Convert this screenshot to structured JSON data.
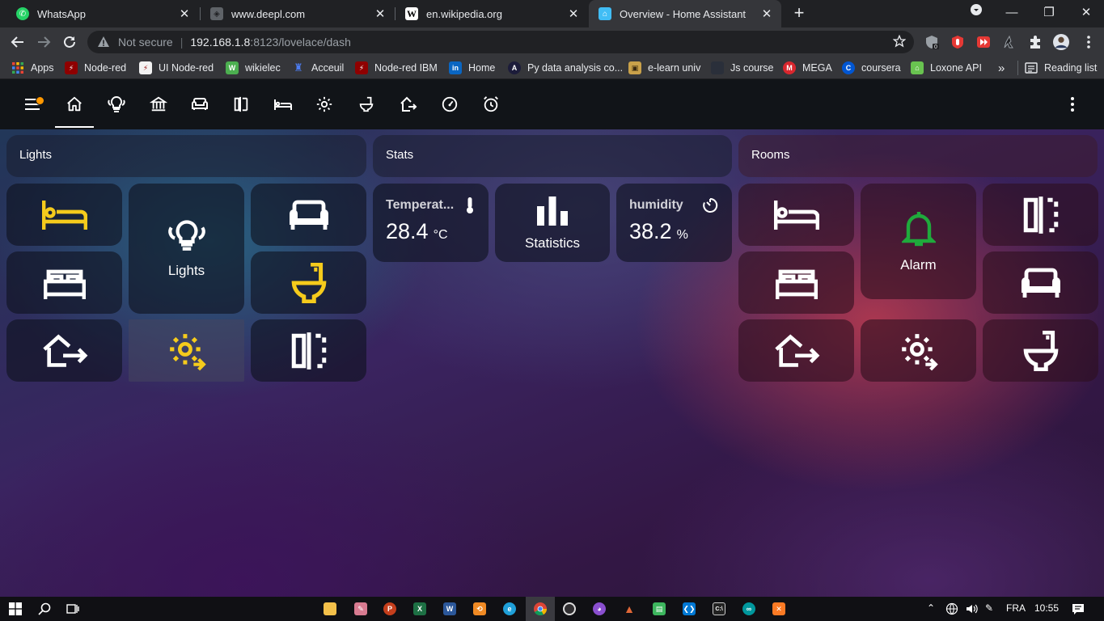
{
  "browser": {
    "tabs": [
      {
        "title": "WhatsApp",
        "icon": "whatsapp-icon"
      },
      {
        "title": "www.deepl.com",
        "icon": "deepl-icon"
      },
      {
        "title": "en.wikipedia.org",
        "icon": "wikipedia-icon"
      },
      {
        "title": "Overview - Home Assistant",
        "icon": "home-assistant-icon"
      }
    ],
    "address": {
      "security": "Not secure",
      "host": "192.168.1.8",
      "path": ":8123/lovelace/dash"
    },
    "bookmarks": [
      {
        "label": "Apps"
      },
      {
        "label": "Node-red"
      },
      {
        "label": "UI Node-red"
      },
      {
        "label": "wikielec"
      },
      {
        "label": "Acceuil"
      },
      {
        "label": "Node-red IBM"
      },
      {
        "label": "Home"
      },
      {
        "label": "Py data analysis co..."
      },
      {
        "label": "e-learn univ"
      },
      {
        "label": "Js course"
      },
      {
        "label": "MEGA"
      },
      {
        "label": "coursera"
      },
      {
        "label": "Loxone API"
      }
    ],
    "more_bookmarks": "»",
    "reading_list": "Reading list"
  },
  "ha": {
    "sections": {
      "lights": {
        "title": "Lights",
        "center_label": "Lights"
      },
      "stats": {
        "title": "Stats",
        "temperature": {
          "name": "Temperat...",
          "value": "28.4",
          "unit": "°C"
        },
        "statistics_label": "Statistics",
        "humidity": {
          "name": "humidity",
          "value": "38.2",
          "unit": "%"
        }
      },
      "rooms": {
        "title": "Rooms",
        "alarm_label": "Alarm"
      }
    },
    "colors": {
      "yellow": "#f5cb1c",
      "green": "#1faa3c",
      "white": "#ffffff"
    }
  },
  "taskbar": {
    "lang": "FRA",
    "time": "10:55"
  }
}
